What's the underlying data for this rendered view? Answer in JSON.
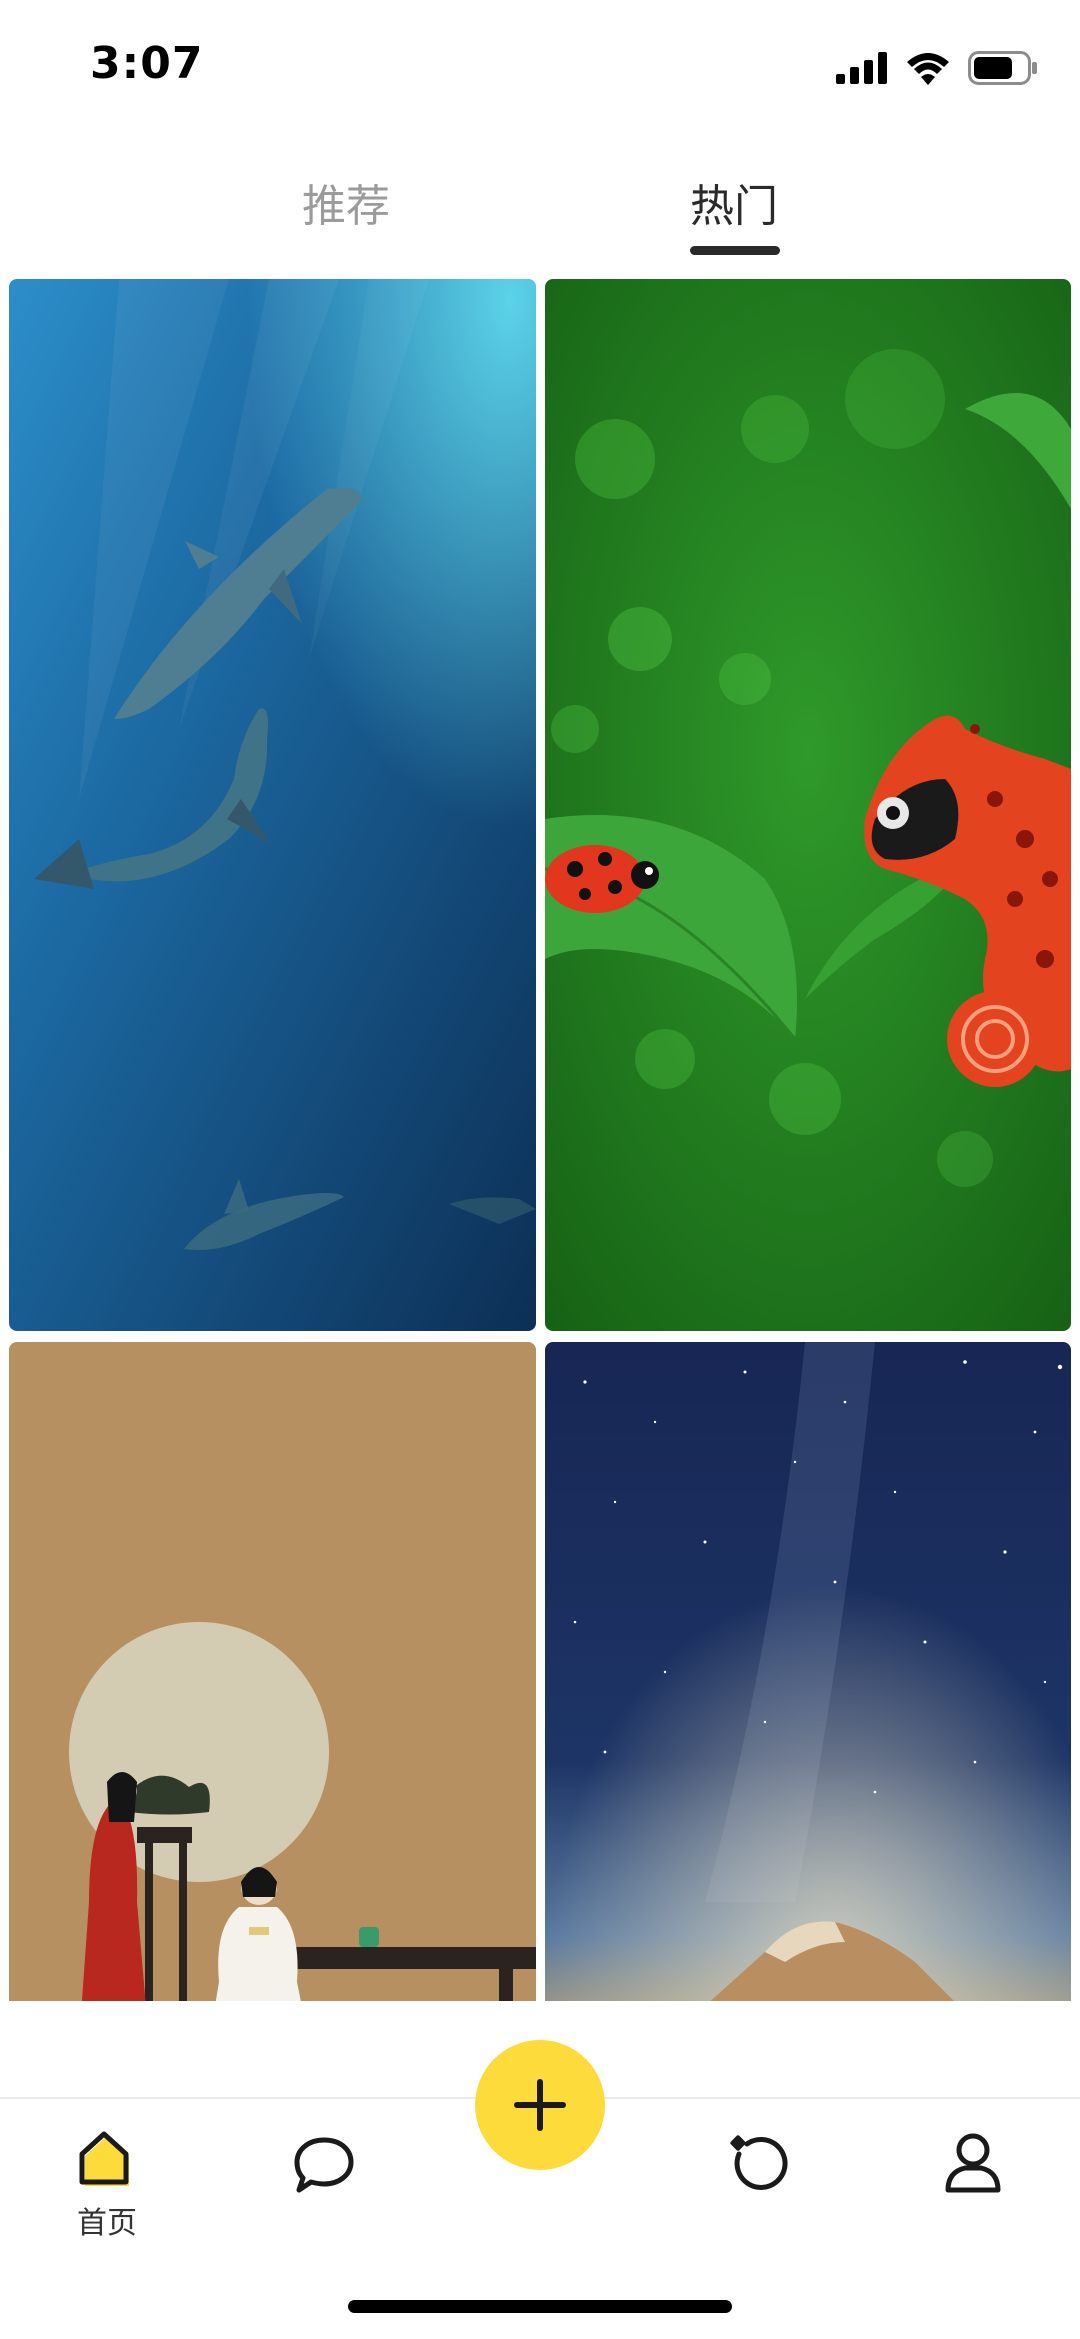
{
  "status_bar": {
    "time": "3:07",
    "icons": [
      "cellular-signal-icon",
      "wifi-icon",
      "battery-icon"
    ]
  },
  "tabs": [
    {
      "label": "推荐",
      "selected": false
    },
    {
      "label": "热门",
      "selected": true
    }
  ],
  "feed": {
    "cards": [
      {
        "subject": "dolphins-underwater"
      },
      {
        "subject": "chameleon-and-ladybug-on-leaf"
      },
      {
        "subject": "ancient-chinese-couple-under-moon"
      },
      {
        "subject": "milky-way-over-mountain"
      }
    ]
  },
  "bottom_nav": {
    "items": [
      {
        "label": "首页",
        "icon": "home-icon",
        "active": true
      },
      {
        "label": "",
        "icon": "chat-bubble-icon",
        "active": false
      },
      {
        "label": "",
        "icon": "discover-icon",
        "active": false
      },
      {
        "label": "",
        "icon": "profile-icon",
        "active": false
      }
    ],
    "fab_icon": "plus-icon"
  },
  "colors": {
    "accent": "#fddb3a",
    "tab_active": "#2a2a2a",
    "tab_inactive": "#9b9b9b"
  }
}
